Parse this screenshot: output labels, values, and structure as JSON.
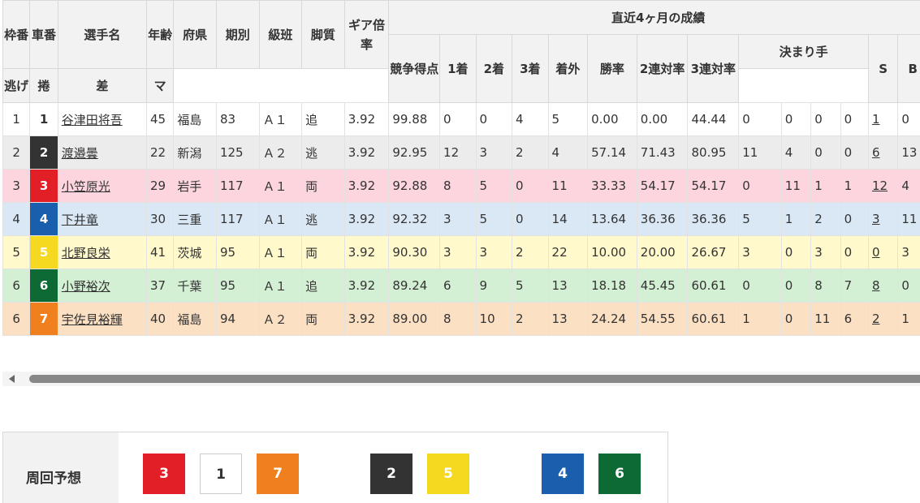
{
  "header": {
    "waku": "枠番",
    "sha": "車番",
    "name": "選手名",
    "age": "年齢",
    "pref": "府県",
    "term": "期別",
    "class": "級班",
    "leg": "脚質",
    "gear": "ギア倍率",
    "recent": "直近4ヶ月の成績",
    "score": "競争得点",
    "first": "1着",
    "second": "2着",
    "third": "3着",
    "out": "着外",
    "winrate": "勝率",
    "rate2": "2連対率",
    "rate3": "3連対率",
    "kimarite": "決まり手",
    "nige": "逃げ",
    "makuri": "捲",
    "sashi": "差",
    "mark": "マ",
    "s": "S",
    "b": "B"
  },
  "riders": [
    {
      "waku": "1",
      "sha": "1",
      "name": "谷津田将吾",
      "age": "45",
      "pref": "福島",
      "term": "83",
      "cls": "Ａ１",
      "leg": "追",
      "gear": "3.92",
      "score": "99.88",
      "first": "0",
      "second": "0",
      "third": "4",
      "out": "5",
      "winrate": "0.00",
      "rate2": "0.00",
      "rate3": "44.44",
      "nige": "0",
      "makuri": "0",
      "sashi": "0",
      "mark": "0",
      "s": "1",
      "b": "0"
    },
    {
      "waku": "2",
      "sha": "2",
      "name": "渡邉曇",
      "age": "22",
      "pref": "新潟",
      "term": "125",
      "cls": "Ａ２",
      "leg": "逃",
      "gear": "3.92",
      "score": "92.95",
      "first": "12",
      "second": "3",
      "third": "2",
      "out": "4",
      "winrate": "57.14",
      "rate2": "71.43",
      "rate3": "80.95",
      "nige": "11",
      "makuri": "4",
      "sashi": "0",
      "mark": "0",
      "s": "6",
      "b": "13"
    },
    {
      "waku": "3",
      "sha": "3",
      "name": "小笠原光",
      "age": "29",
      "pref": "岩手",
      "term": "117",
      "cls": "Ａ１",
      "leg": "両",
      "gear": "3.92",
      "score": "92.88",
      "first": "8",
      "second": "5",
      "third": "0",
      "out": "11",
      "winrate": "33.33",
      "rate2": "54.17",
      "rate3": "54.17",
      "nige": "0",
      "makuri": "11",
      "sashi": "1",
      "mark": "1",
      "s": "12",
      "b": "4"
    },
    {
      "waku": "4",
      "sha": "4",
      "name": "下井竜",
      "age": "30",
      "pref": "三重",
      "term": "117",
      "cls": "Ａ１",
      "leg": "逃",
      "gear": "3.92",
      "score": "92.32",
      "first": "3",
      "second": "5",
      "third": "0",
      "out": "14",
      "winrate": "13.64",
      "rate2": "36.36",
      "rate3": "36.36",
      "nige": "5",
      "makuri": "1",
      "sashi": "2",
      "mark": "0",
      "s": "3",
      "b": "11"
    },
    {
      "waku": "5",
      "sha": "5",
      "name": "北野良栄",
      "age": "41",
      "pref": "茨城",
      "term": "95",
      "cls": "Ａ１",
      "leg": "両",
      "gear": "3.92",
      "score": "90.30",
      "first": "3",
      "second": "3",
      "third": "2",
      "out": "22",
      "winrate": "10.00",
      "rate2": "20.00",
      "rate3": "26.67",
      "nige": "3",
      "makuri": "0",
      "sashi": "3",
      "mark": "0",
      "s": "0",
      "b": "3"
    },
    {
      "waku": "6",
      "sha": "6",
      "name": "小野裕次",
      "age": "37",
      "pref": "千葉",
      "term": "95",
      "cls": "Ａ１",
      "leg": "追",
      "gear": "3.92",
      "score": "89.24",
      "first": "6",
      "second": "9",
      "third": "5",
      "out": "13",
      "winrate": "18.18",
      "rate2": "45.45",
      "rate3": "60.61",
      "nige": "0",
      "makuri": "0",
      "sashi": "8",
      "mark": "7",
      "s": "8",
      "b": "0"
    },
    {
      "waku": "6",
      "sha": "7",
      "name": "宇佐見裕輝",
      "age": "40",
      "pref": "福島",
      "term": "94",
      "cls": "Ａ２",
      "leg": "両",
      "gear": "3.92",
      "score": "89.00",
      "first": "8",
      "second": "10",
      "third": "2",
      "out": "13",
      "winrate": "24.24",
      "rate2": "54.55",
      "rate3": "60.61",
      "nige": "1",
      "makuri": "0",
      "sashi": "11",
      "mark": "6",
      "s": "2",
      "b": "1"
    }
  ],
  "car_colors": {
    "1": {
      "bg": "#ffffff",
      "fg": "#333333"
    },
    "2": {
      "bg": "#333333",
      "fg": "#ffffff"
    },
    "3": {
      "bg": "#e21e26",
      "fg": "#ffffff"
    },
    "4": {
      "bg": "#1a5fae",
      "fg": "#ffffff"
    },
    "5": {
      "bg": "#f5d820",
      "fg": "#ffffff"
    },
    "6": {
      "bg": "#0e6a34",
      "fg": "#ffffff"
    },
    "7": {
      "bg": "#f07f1e",
      "fg": "#ffffff"
    }
  },
  "prediction": {
    "label": "周回予想",
    "order": [
      "3",
      "1",
      "7",
      "2",
      "5",
      "4",
      "6"
    ]
  }
}
